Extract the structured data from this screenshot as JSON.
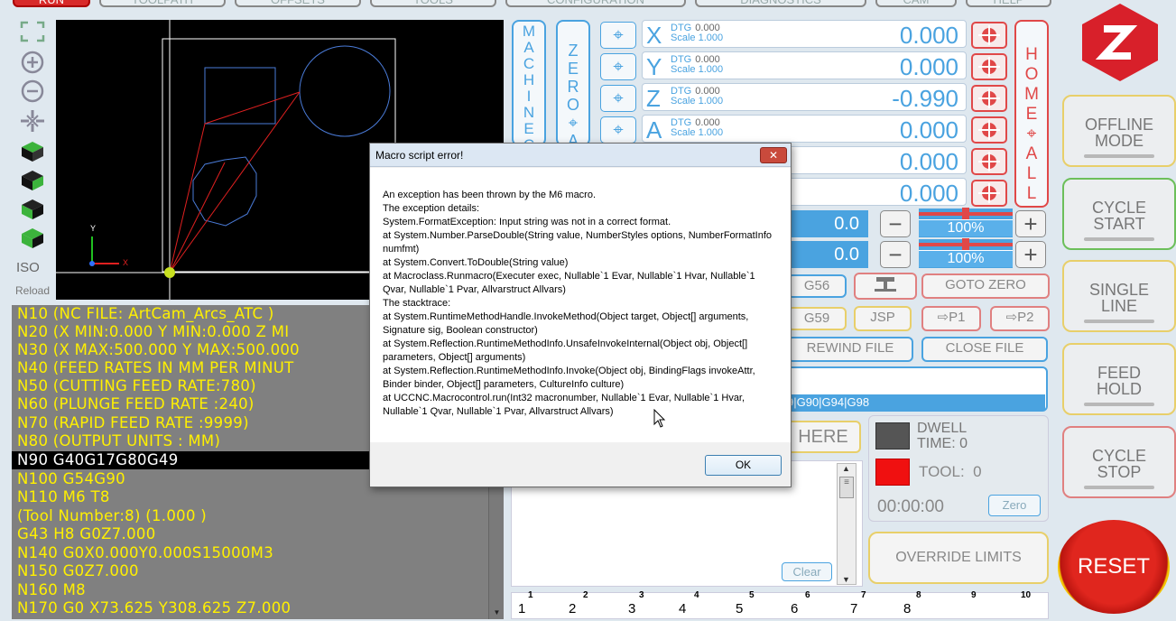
{
  "tabs": [
    "RUN",
    "TOOLPATH",
    "OFFSETS",
    "TOOLS",
    "CONFIGURATION",
    "DIAGNOSTICS",
    "CAM",
    "HELP"
  ],
  "left_toolbar": {
    "zoom_fit_icon": "zoom-fit-icon",
    "zoom_in_icon": "zoom-in-icon",
    "zoom_out_icon": "zoom-out-icon",
    "pan_icon": "pan-icon",
    "iso_label": "ISO",
    "reload_label": "Reload"
  },
  "view": {
    "axis_y": "Y",
    "axis_x": "X"
  },
  "gcode": {
    "lines": [
      "N10 (NC FILE: ArtCam_Arcs_ATC )",
      "N20 (X MIN:0.000  Y MIN:0.000   Z MI",
      "N30 (X MAX:500.000  Y MAX:500.000",
      "N40 (FEED RATES IN MM PER MINUT",
      "N50 (CUTTING FEED RATE:780)",
      "N60 (PLUNGE FEED RATE :240)",
      "N70 (RAPID FEED RATE  :9999)",
      "N80 (OUTPUT UNITS : MM)",
      "N90  G40G17G80G49",
      "N100  G54G90",
      "N110  M6 T8",
      "(Tool Number:8) (1.000    )",
      "G43 H8 G0Z7.000",
      "N140  G0X0.000Y0.000S15000M3",
      "N150  G0Z7.000",
      "N160  M8",
      "N170  G0 X73.625 Y308.625 Z7.000"
    ],
    "highlighted_index": 8
  },
  "side_buttons": {
    "machine_coords": "MACHINE CO",
    "zero_all": "ZERO ALL",
    "home_all": "HOME ALL"
  },
  "dro": [
    {
      "axis": "X",
      "dtg_label": "DTG",
      "dtg": "0.000",
      "scale_label": "Scale",
      "scale": "1.000",
      "value": "0.000"
    },
    {
      "axis": "Y",
      "dtg_label": "DTG",
      "dtg": "0.000",
      "scale_label": "Scale",
      "scale": "1.000",
      "value": "0.000"
    },
    {
      "axis": "Z",
      "dtg_label": "DTG",
      "dtg": "0.000",
      "scale_label": "Scale",
      "scale": "1.000",
      "value": "-0.990"
    },
    {
      "axis": "A",
      "dtg_label": "DTG",
      "dtg": "0.000",
      "scale_label": "Scale",
      "scale": "1.000",
      "value": "0.000"
    },
    {
      "axis": "",
      "value": "0.000"
    },
    {
      "axis": "",
      "value": "0.000"
    }
  ],
  "feed": {
    "value": "0.0",
    "percent": "100%",
    "fill": 0.5
  },
  "spindle": {
    "value": "0.0",
    "percent": "100%",
    "fill": 0.5
  },
  "buttons": {
    "g56": "G56",
    "goto_zero": "GOTO ZERO",
    "g59": "G59",
    "jsp": "JSP",
    "p1": "P1",
    "p2": "P2",
    "rewind": "REWIND FILE",
    "close": "CLOSE FILE",
    "here": "HERE",
    "clear": "Clear",
    "zero": "Zero",
    "override": "OVERRIDE LIMITS",
    "reset": "RESET"
  },
  "modal_codes": "9|G90|G94|G98",
  "status": {
    "dwell_label": "DWELL",
    "dwell_time_label": "TIME:",
    "dwell_time": "0",
    "tool_label": "TOOL:",
    "tool": "0",
    "timer": "00:00:00"
  },
  "right_panel": {
    "offline": "OFFLINE MODE",
    "cycle_start": "CYCLE START",
    "single_line": "SINGLE LINE",
    "feed_hold": "FEED HOLD",
    "cycle_stop": "CYCLE STOP"
  },
  "ruler": {
    "top": [
      "1",
      "2",
      "3",
      "4",
      "5",
      "6",
      "7",
      "8",
      "9",
      "10"
    ],
    "bottom": [
      "1",
      "2",
      "3",
      "4",
      "5",
      "6",
      "7",
      "8"
    ]
  },
  "dialog": {
    "title": "Macro script error!",
    "close": "✕",
    "lines": [
      "An exception has been thrown by the M6 macro.",
      " The exception details:",
      " System.FormatException: Input string was not in a correct format.",
      "    at System.Number.ParseDouble(String value, NumberStyles options, NumberFormatInfo numfmt)",
      "    at System.Convert.ToDouble(String value)",
      "    at Macroclass.Runmacro(Executer exec, Nullable`1 Evar, Nullable`1 Hvar, Nullable`1 Qvar, Nullable`1 Pvar, Allvarstruct Allvars)",
      " The stacktrace:",
      "    at System.RuntimeMethodHandle.InvokeMethod(Object target, Object[] arguments, Signature sig, Boolean constructor)",
      "    at System.Reflection.RuntimeMethodInfo.UnsafeInvokeInternal(Object obj, Object[] parameters, Object[] arguments)",
      "    at System.Reflection.RuntimeMethodInfo.Invoke(Object obj, BindingFlags invokeAttr, Binder binder, Object[] parameters, CultureInfo culture)",
      "    at UCCNC.Macrocontrol.run(Int32 macronumber, Nullable`1 Evar, Nullable`1 Hvar, Nullable`1 Qvar, Nullable`1 Pvar, Allvarstruct Allvars)"
    ],
    "ok": "OK"
  }
}
